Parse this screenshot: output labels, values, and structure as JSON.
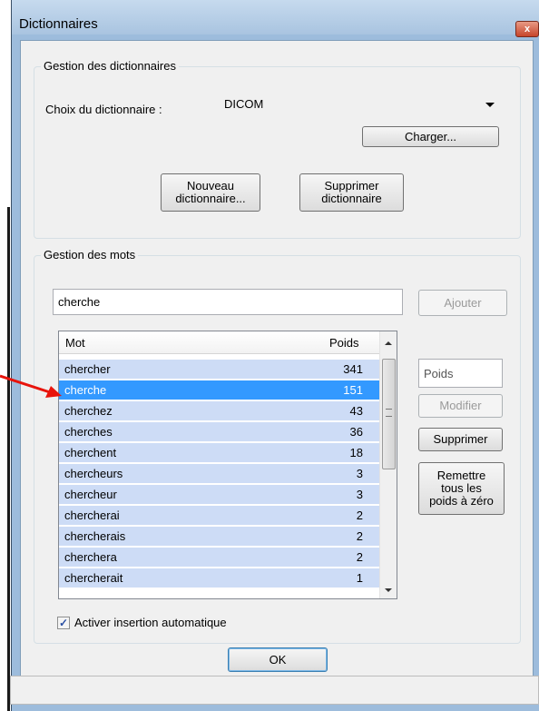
{
  "window": {
    "title": "Dictionnaires",
    "close_label": "x"
  },
  "dict_group": {
    "title": "Gestion des dictionnaires",
    "choice_label": "Choix du dictionnaire :",
    "selected": "DICOM",
    "load_button": "Charger...",
    "new_button_line1": "Nouveau",
    "new_button_line2": "dictionnaire...",
    "delete_button_line1": "Supprimer",
    "delete_button_line2": "dictionnaire"
  },
  "words_group": {
    "title": "Gestion des mots",
    "word_input": "cherche",
    "add_button": "Ajouter",
    "weight_placeholder": "Poids",
    "modify_button": "Modifier",
    "delete_button": "Supprimer",
    "reset_line1": "Remettre",
    "reset_line2": "tous les",
    "reset_line3": "poids à zéro",
    "columns": {
      "mot": "Mot",
      "poids": "Poids"
    },
    "rows": [
      {
        "mot": "chercher",
        "poids": "341"
      },
      {
        "mot": "cherche",
        "poids": "151"
      },
      {
        "mot": "cherchez",
        "poids": "43"
      },
      {
        "mot": "cherches",
        "poids": "36"
      },
      {
        "mot": "cherchent",
        "poids": "18"
      },
      {
        "mot": "chercheurs",
        "poids": "3"
      },
      {
        "mot": "chercheur",
        "poids": "3"
      },
      {
        "mot": "chercherai",
        "poids": "2"
      },
      {
        "mot": "chercherais",
        "poids": "2"
      },
      {
        "mot": "cherchera",
        "poids": "2"
      },
      {
        "mot": "chercherait",
        "poids": "1"
      }
    ],
    "auto_insert_label": "Activer insertion automatique",
    "auto_insert_checked": true
  },
  "ok_button": "OK",
  "colors": {
    "selection": "#3399ff",
    "row_bg": "#cddcf6",
    "arrow": "#e8140c"
  }
}
